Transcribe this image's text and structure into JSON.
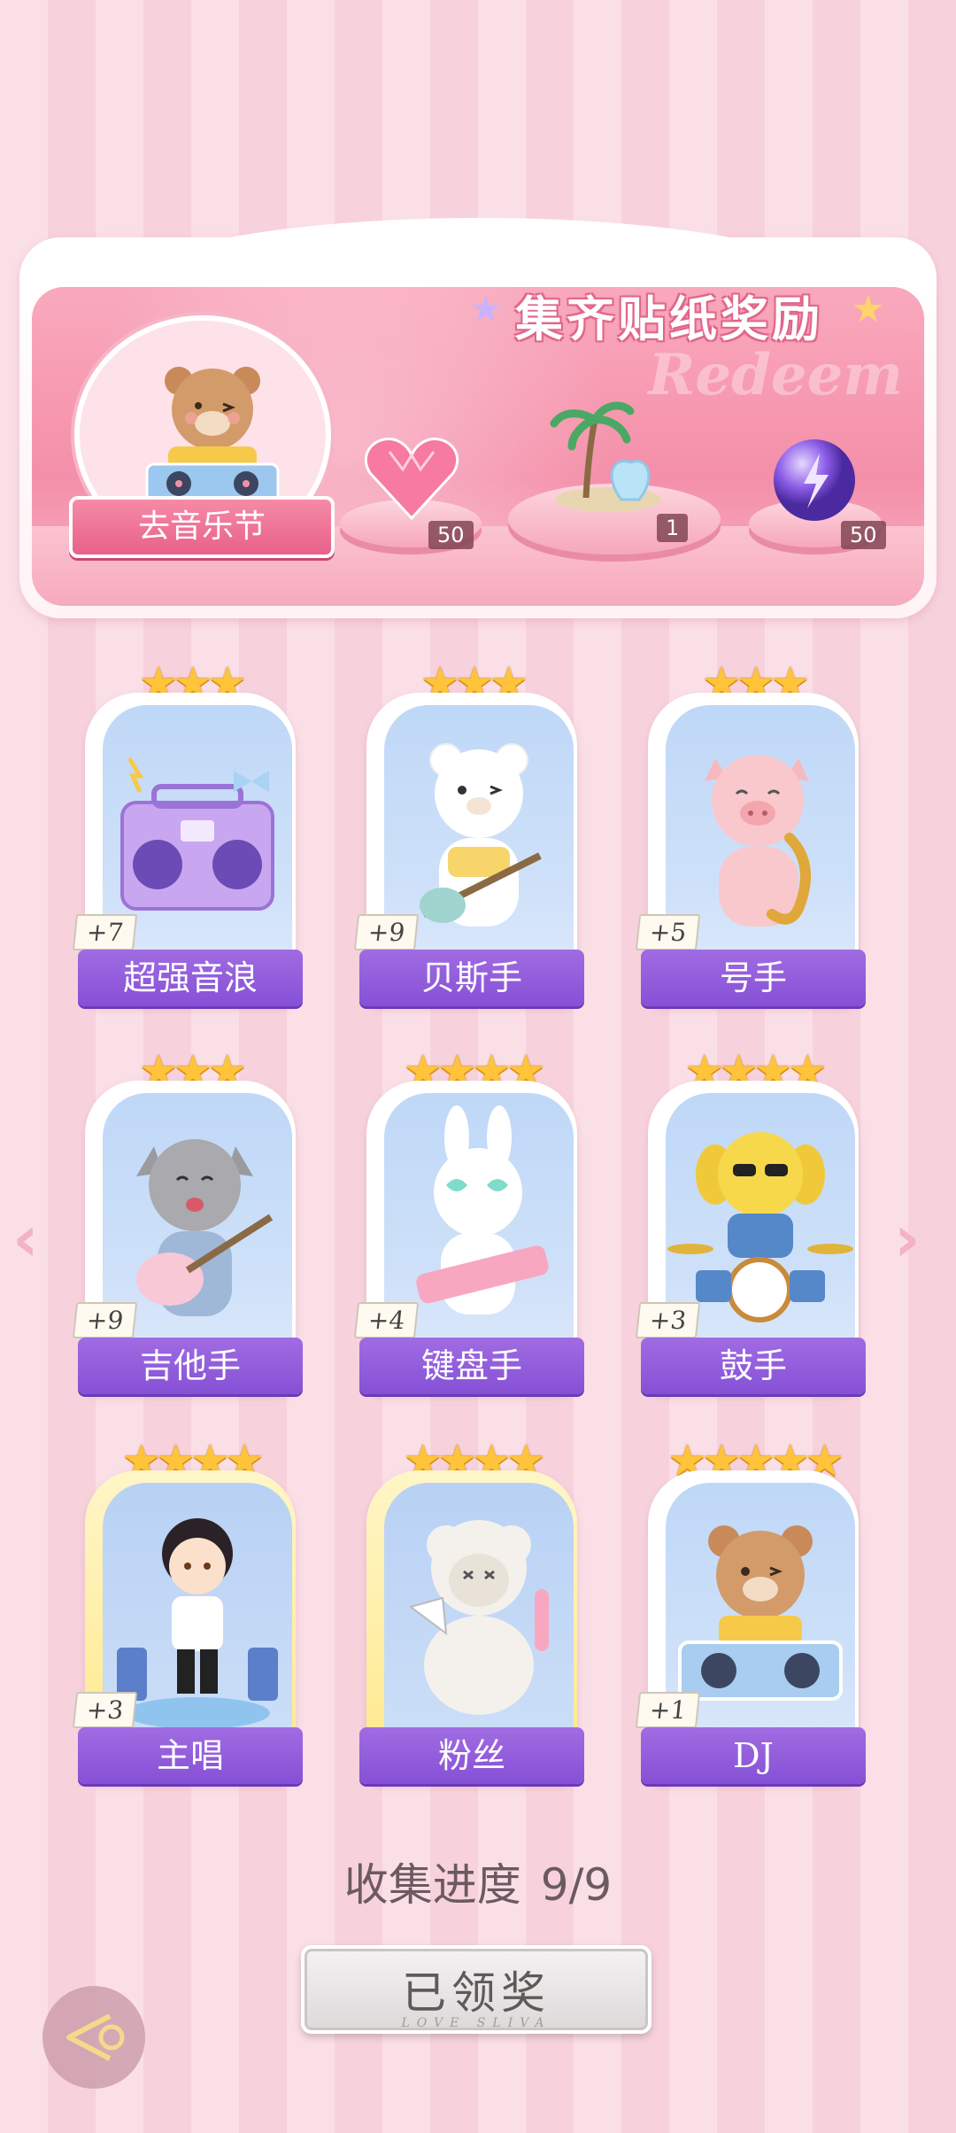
{
  "banner": {
    "title": "集齐贴纸奖励",
    "watermark": "Redeem",
    "festival_button": "去音乐节",
    "rewards": [
      {
        "icon": "pink-heart-gem-icon",
        "count": "50"
      },
      {
        "icon": "palm-island-icon",
        "count": "1"
      },
      {
        "icon": "purple-energy-orb-icon",
        "count": "50"
      }
    ]
  },
  "cards": [
    {
      "name": "超强音浪",
      "count": "+7",
      "stars": "★★★",
      "art": "boombox-icon"
    },
    {
      "name": "贝斯手",
      "count": "+9",
      "stars": "★★★",
      "art": "bear-bass-icon"
    },
    {
      "name": "号手",
      "count": "+5",
      "stars": "★★★",
      "art": "pig-sax-icon"
    },
    {
      "name": "吉他手",
      "count": "+9",
      "stars": "★★★",
      "art": "cat-guitar-icon"
    },
    {
      "name": "键盘手",
      "count": "+4",
      "stars": "★★★★",
      "art": "bunny-keytar-icon"
    },
    {
      "name": "鼓手",
      "count": "+3",
      "stars": "★★★★",
      "art": "dog-drums-icon"
    },
    {
      "name": "主唱",
      "count": "+3",
      "stars": "★★★★",
      "art": "singer-boy-icon"
    },
    {
      "name": "粉丝",
      "count": "",
      "stars": "★★★★",
      "art": "sheep-fan-icon"
    },
    {
      "name": "DJ",
      "count": "+1",
      "stars": "★★★★★",
      "art": "bear-dj-icon"
    }
  ],
  "progress": {
    "label": "收集进度",
    "value": "9/9"
  },
  "claim": {
    "label": "已领奖",
    "sub": "LOVE SLIVA"
  },
  "colors": {
    "accent_purple": "#8650d6",
    "banner_pink": "#f48fa9",
    "star_gold": "#ffc43a"
  }
}
